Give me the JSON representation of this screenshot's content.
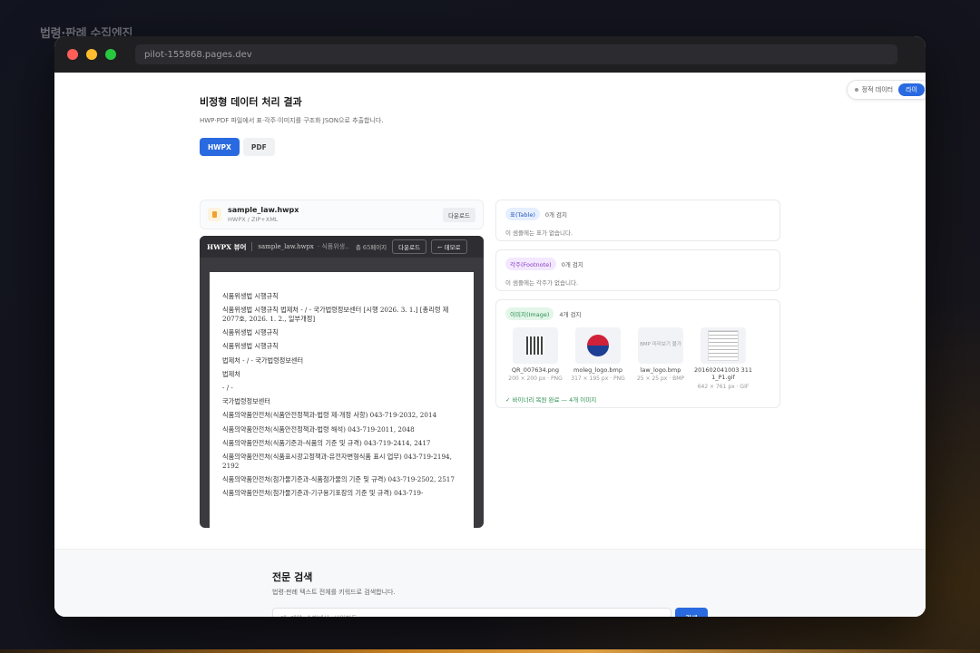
{
  "page_title": "법령·판례 수집엔진",
  "browser": {
    "url": "pilot-155868.pages.dev"
  },
  "toggle": {
    "label": "정적 데이터",
    "active_label": "라이"
  },
  "header": {
    "title": "비정형 데이터 처리 결과",
    "subtitle": "HWP·PDF 파일에서 표·각주·이미지를 구조화 JSON으로 추출합니다."
  },
  "tabs": [
    {
      "label": "HWPX"
    },
    {
      "label": "PDF"
    }
  ],
  "file": {
    "name": "sample_law.hwpx",
    "meta": "HWPX / ZIP+XML",
    "download_label": "다운로드"
  },
  "viewer": {
    "title": "HWPX 뷰어",
    "file": "sample_law.hwpx",
    "tail": "· 식품위생…",
    "pages": "총 65페이지",
    "download_label": "다운로드",
    "back_label": "← 데모로",
    "lines": [
      "식품위생법 시행규칙",
      "식품위생법 시행규칙 법제처 - / - 국가법령정보센터 [시행 2026. 3. 1.] [총리령 제2077호, 2026. 1. 2., 일부개정]",
      "식품위생법 시행규칙",
      "식품위생법 시행규칙",
      "법제처 - / - 국가법령정보센터",
      "법제처",
      "- / -",
      "국가법령정보센터",
      "식품의약품안전처(식품안전정책과-법령 제·개정 사항) 043-719-2032, 2014",
      "식품의약품안전처(식품안전정책과-법령 해석) 043-719-2011, 2048",
      "식품의약품안전처(식품기준과-식품의 기준 및 규격) 043-719-2414, 2417",
      "식품의약품안전처(식품표시광고정책과-유전자변형식품 표시 업무) 043-719-2194, 2192",
      "식품의약품안전처(첨가물기준과-식품첨가물의 기준 및 규격) 043-719-2502, 2517",
      "식품의약품안전처(첨가물기준과-기구용기포장의 기준 및 규격) 043-719-"
    ]
  },
  "tables_card": {
    "badge": "표(Table)",
    "count": "0개 검지",
    "note": "이 샘플에는 표가 없습니다."
  },
  "footnotes_card": {
    "badge": "각주(Footnote)",
    "count": "0개 검지",
    "note": "이 샘플에는 각주가 없습니다."
  },
  "images_card": {
    "badge": "이미지(Image)",
    "count": "4개 검지",
    "items": [
      {
        "name": "QR_007634.png",
        "meta": "200 × 200 px · PNG",
        "icon": "qr-code-icon"
      },
      {
        "name": "moleg_logo.bmp",
        "meta": "317 × 195 px · PNG",
        "icon": "taegeuk-logo-icon"
      },
      {
        "name": "law_logo.bmp",
        "meta": "25 × 25 px · BMP",
        "icon": "bmp-placeholder-icon",
        "placeholder": "BMP 미리보기 불가"
      },
      {
        "name": "201602041003 3111_P1.gif",
        "meta": "642 × 761 px · GIF",
        "icon": "document-thumb-icon"
      }
    ],
    "status": "✓ 바이너리 복원 완료 — 4개 이미지"
  },
  "search": {
    "title": "전문 검색",
    "subtitle": "법령·판례 텍스트 전체를 키워드로 검색합니다.",
    "placeholder": "예: 계약, 손해배상, 선의취득",
    "button_label": "검색"
  }
}
